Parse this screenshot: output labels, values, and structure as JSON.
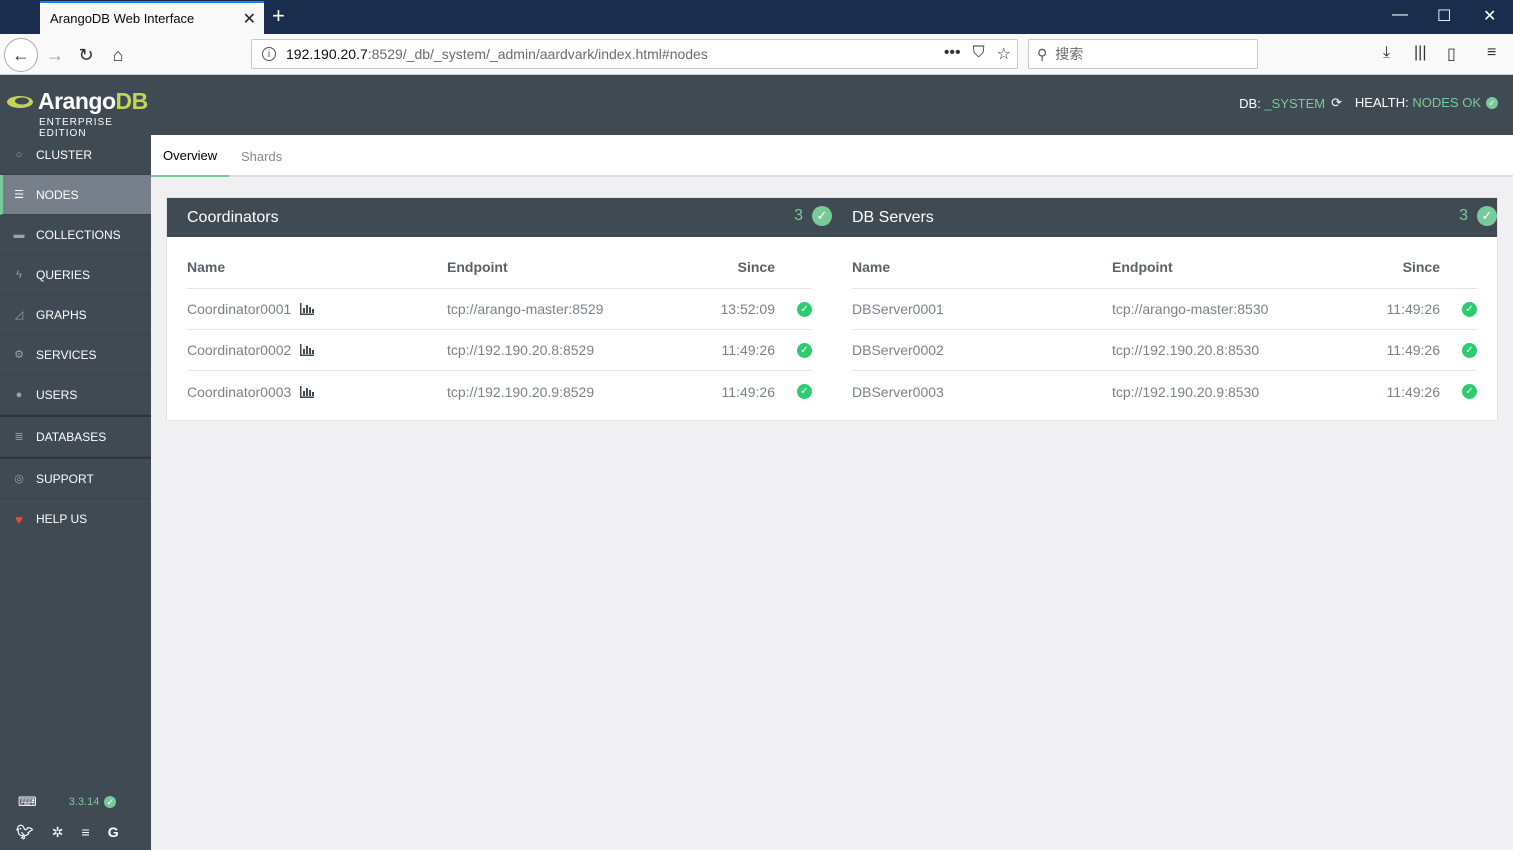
{
  "browser": {
    "tab_title": "ArangoDB Web Interface",
    "url_host": "192.190.20.7",
    "url_rest": ":8529/_db/_system/_admin/aardvark/index.html#nodes",
    "search_placeholder": "搜索"
  },
  "brand": {
    "name_main": "Arango",
    "name_accent": "DB",
    "edition": "ENTERPRISE EDITION"
  },
  "sidebar": {
    "items": [
      {
        "label": "CLUSTER",
        "icon": "circle-icon"
      },
      {
        "label": "NODES",
        "icon": "server-icon"
      },
      {
        "label": "COLLECTIONS",
        "icon": "folder-icon"
      },
      {
        "label": "QUERIES",
        "icon": "bolt-icon"
      },
      {
        "label": "GRAPHS",
        "icon": "area-chart-icon"
      },
      {
        "label": "SERVICES",
        "icon": "cogs-icon"
      },
      {
        "label": "USERS",
        "icon": "users-icon"
      },
      {
        "label": "DATABASES",
        "icon": "database-icon"
      },
      {
        "label": "SUPPORT",
        "icon": "lifesaver-icon"
      },
      {
        "label": "HELP US",
        "icon": "heart-icon"
      }
    ],
    "version": "3.3.14"
  },
  "topbar": {
    "db_label": "DB:",
    "db_value": "_SYSTEM",
    "health_label": "HEALTH:",
    "health_value": "NODES OK"
  },
  "tabs": [
    {
      "label": "Overview",
      "active": true
    },
    {
      "label": "Shards",
      "active": false
    }
  ],
  "coordinators": {
    "title": "Coordinators",
    "count": "3",
    "headers": {
      "name": "Name",
      "endpoint": "Endpoint",
      "since": "Since"
    },
    "rows": [
      {
        "name": "Coordinator0001",
        "endpoint": "tcp://arango-master:8529",
        "since": "13:52:09"
      },
      {
        "name": "Coordinator0002",
        "endpoint": "tcp://192.190.20.8:8529",
        "since": "11:49:26"
      },
      {
        "name": "Coordinator0003",
        "endpoint": "tcp://192.190.20.9:8529",
        "since": "11:49:26"
      }
    ]
  },
  "dbservers": {
    "title": "DB Servers",
    "count": "3",
    "headers": {
      "name": "Name",
      "endpoint": "Endpoint",
      "since": "Since"
    },
    "rows": [
      {
        "name": "DBServer0001",
        "endpoint": "tcp://arango-master:8530",
        "since": "11:49:26"
      },
      {
        "name": "DBServer0002",
        "endpoint": "tcp://192.190.20.8:8530",
        "since": "11:49:26"
      },
      {
        "name": "DBServer0003",
        "endpoint": "tcp://192.190.20.9:8530",
        "since": "11:49:26"
      }
    ]
  },
  "colors": {
    "accent": "#77cb99",
    "sidebar": "#404a53",
    "status_ok": "#2ecc71"
  }
}
